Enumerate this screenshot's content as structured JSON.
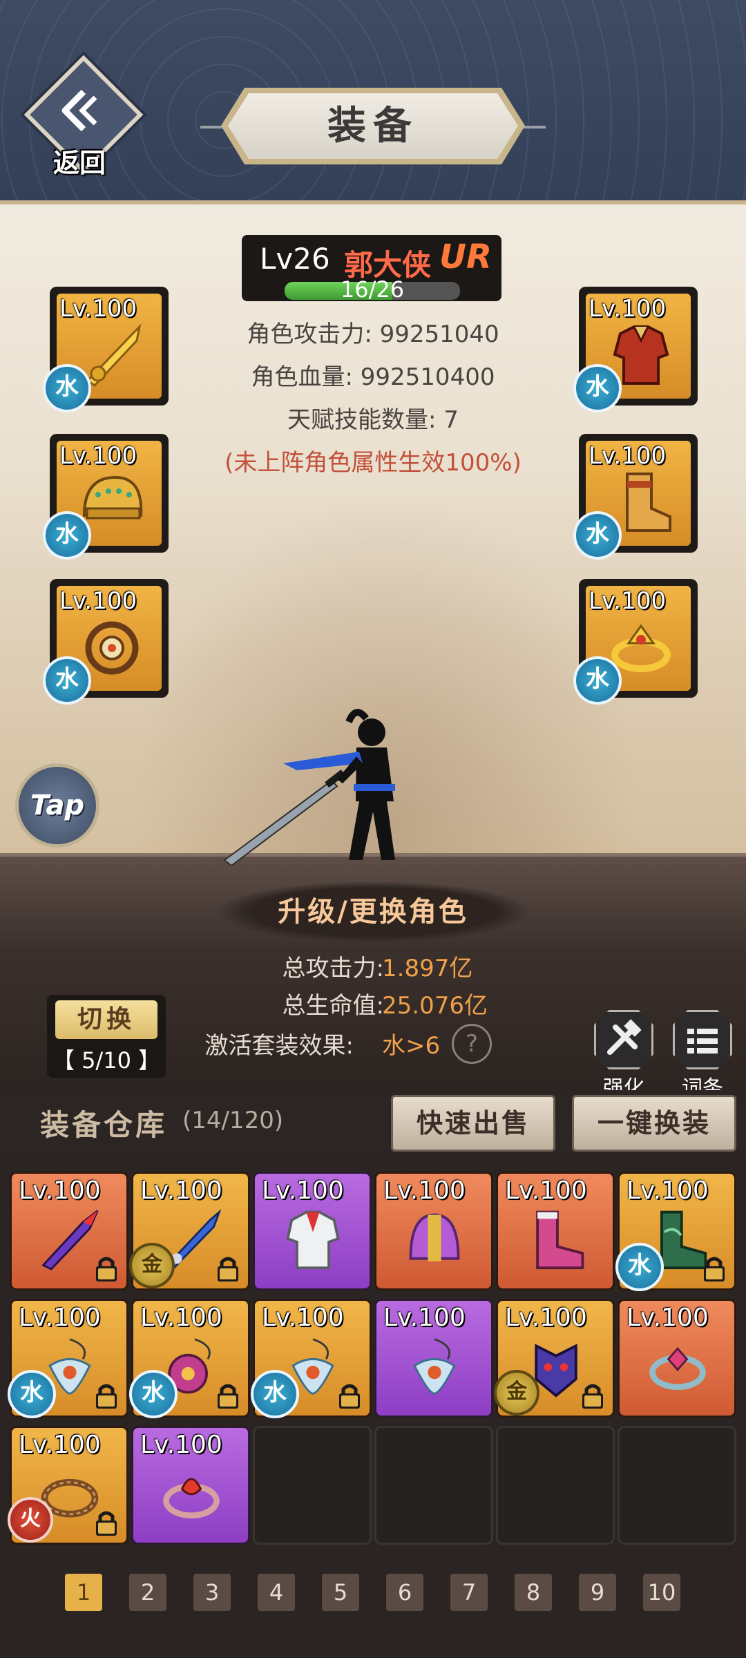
{
  "header": {
    "back_label": "返回",
    "title": "装备"
  },
  "hero": {
    "level": "Lv26",
    "name": "郭大侠",
    "rank": "UR",
    "progress_text": "16/26",
    "progress": 0.615,
    "attack_line": "角色攻击力: 99251040",
    "hp_line": "角色血量: 992510400",
    "talent_line": "天赋技能数量: 7",
    "note_line": "(未上阵角色属性生效100%)"
  },
  "slots": [
    {
      "level": "Lv.100",
      "badge": "水",
      "icon": "golden-sword-icon"
    },
    {
      "level": "Lv.100",
      "badge": "水",
      "icon": "golden-helmet-icon"
    },
    {
      "level": "Lv.100",
      "badge": "水",
      "icon": "amulet-icon"
    },
    {
      "level": "Lv.100",
      "badge": "水",
      "icon": "red-armor-icon"
    },
    {
      "level": "Lv.100",
      "badge": "水",
      "icon": "golden-boots-icon"
    },
    {
      "level": "Lv.100",
      "badge": "水",
      "icon": "golden-ring-icon"
    }
  ],
  "tap_label": "Tap",
  "upgrade_label": "升级/更换角色",
  "totals": {
    "attack_label": "总攻击力:",
    "attack_value": "1.897亿",
    "hp_label": "总生命值:",
    "hp_value": "25.076亿",
    "set_label": "激活套装效果:",
    "set_value": "水>6",
    "help": "?"
  },
  "switch": {
    "label": "切换",
    "count": "【 5/10 】"
  },
  "tools": {
    "enhance": "强化",
    "entries": "词条"
  },
  "warehouse": {
    "title": "装备仓库",
    "count": "(14/120)",
    "quick_sell": "快速出售",
    "one_key_equip": "一键换装"
  },
  "items": [
    {
      "level": "Lv.100",
      "rarity": "red",
      "badge": "",
      "locked": true,
      "icon": "purple-blade-icon"
    },
    {
      "level": "Lv.100",
      "rarity": "orange",
      "badge": "金",
      "locked": true,
      "icon": "blue-sword-icon"
    },
    {
      "level": "Lv.100",
      "rarity": "purple",
      "badge": "",
      "locked": false,
      "icon": "white-armor-icon"
    },
    {
      "level": "Lv.100",
      "rarity": "red",
      "badge": "",
      "locked": false,
      "icon": "purple-helmet-icon"
    },
    {
      "level": "Lv.100",
      "rarity": "red",
      "badge": "",
      "locked": false,
      "icon": "pink-boots-icon"
    },
    {
      "level": "Lv.100",
      "rarity": "orange",
      "badge": "水",
      "locked": true,
      "icon": "green-boots-icon"
    },
    {
      "level": "Lv.100",
      "rarity": "orange",
      "badge": "水",
      "locked": true,
      "icon": "winged-pendant-icon"
    },
    {
      "level": "Lv.100",
      "rarity": "orange",
      "badge": "水",
      "locked": true,
      "icon": "orb-pendant-icon"
    },
    {
      "level": "Lv.100",
      "rarity": "orange",
      "badge": "水",
      "locked": true,
      "icon": "winged-pendant-icon"
    },
    {
      "level": "Lv.100",
      "rarity": "purple",
      "badge": "",
      "locked": false,
      "icon": "winged-pendant-icon"
    },
    {
      "level": "Lv.100",
      "rarity": "orange",
      "badge": "金",
      "locked": true,
      "icon": "demon-mask-icon"
    },
    {
      "level": "Lv.100",
      "rarity": "red",
      "badge": "",
      "locked": false,
      "icon": "jeweled-ring-icon"
    },
    {
      "level": "Lv.100",
      "rarity": "orange",
      "badge": "火",
      "locked": true,
      "icon": "thorn-ring-icon"
    },
    {
      "level": "Lv.100",
      "rarity": "purple",
      "badge": "",
      "locked": false,
      "icon": "dragon-ring-icon"
    }
  ],
  "pages": [
    "1",
    "2",
    "3",
    "4",
    "5",
    "6",
    "7",
    "8",
    "9",
    "10"
  ],
  "active_page": "1",
  "colors": {
    "accent": "#f0a14a",
    "name": "#ff6a4a",
    "water": "#1b6f9e"
  }
}
